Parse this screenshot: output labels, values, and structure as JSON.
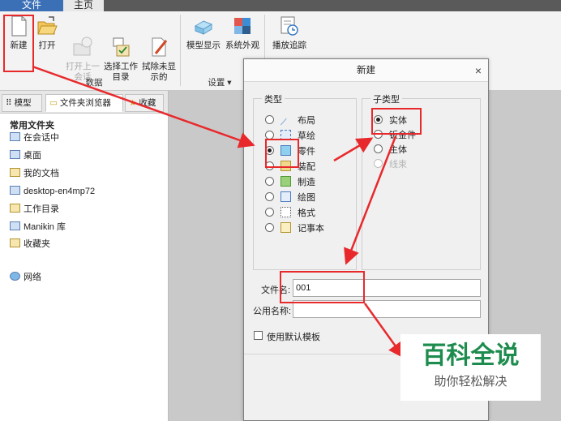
{
  "menubar": {
    "file_tab": "文件",
    "home_tab": "主页"
  },
  "ribbon": {
    "buttons": [
      {
        "label": "新建",
        "icon": "new-file-icon"
      },
      {
        "label": "打开",
        "icon": "open-folder-icon"
      },
      {
        "label": "打开上一\n会话",
        "icon": "open-last-session-icon",
        "disabled": true
      },
      {
        "label": "选择工作\n目录",
        "icon": "select-working-directory-icon"
      },
      {
        "label": "拭除未显\n示的",
        "icon": "erase-not-displayed-icon"
      },
      {
        "label": "模型显示",
        "icon": "model-display-icon"
      },
      {
        "label": "系统外观",
        "icon": "system-appearance-icon"
      },
      {
        "label": "播放追踪",
        "icon": "play-trail-icon"
      }
    ],
    "group_data": "数据",
    "group_settings": "设置 ▾"
  },
  "left_panel": {
    "tabs": [
      "模型",
      "文件夹浏览器",
      "收藏"
    ],
    "section_title": "常用文件夹",
    "items": [
      "在会话中",
      "桌面",
      "我的文档",
      "desktop-en4mp72",
      "工作目录",
      "Manikin 库",
      "收藏夹",
      "网络"
    ]
  },
  "dialog": {
    "title": "新建",
    "close": "×",
    "type_group": "类型",
    "types": [
      {
        "label": "布局",
        "selected": false
      },
      {
        "label": "草绘",
        "selected": false
      },
      {
        "label": "零件",
        "selected": true
      },
      {
        "label": "装配",
        "selected": false
      },
      {
        "label": "制造",
        "selected": false
      },
      {
        "label": "绘图",
        "selected": false
      },
      {
        "label": "格式",
        "selected": false
      },
      {
        "label": "记事本",
        "selected": false
      }
    ],
    "subtype_group": "子类型",
    "subtypes": [
      {
        "label": "实体",
        "selected": true,
        "disabled": false
      },
      {
        "label": "钣金件",
        "selected": false,
        "disabled": false
      },
      {
        "label": "主体",
        "selected": false,
        "disabled": false
      },
      {
        "label": "线束",
        "selected": false,
        "disabled": true
      }
    ],
    "file_name_label": "文件名:",
    "file_name_value": "001",
    "common_name_label": "公用名称:",
    "common_name_value": "",
    "use_default_template": "使用默认模板"
  },
  "watermark": {
    "main": "百科全说",
    "sub": "助你轻松解决"
  },
  "colors": {
    "annotation_red": "#e8292c",
    "brand_green": "#1e8c4e",
    "file_tab_blue": "#3b6fb6"
  }
}
